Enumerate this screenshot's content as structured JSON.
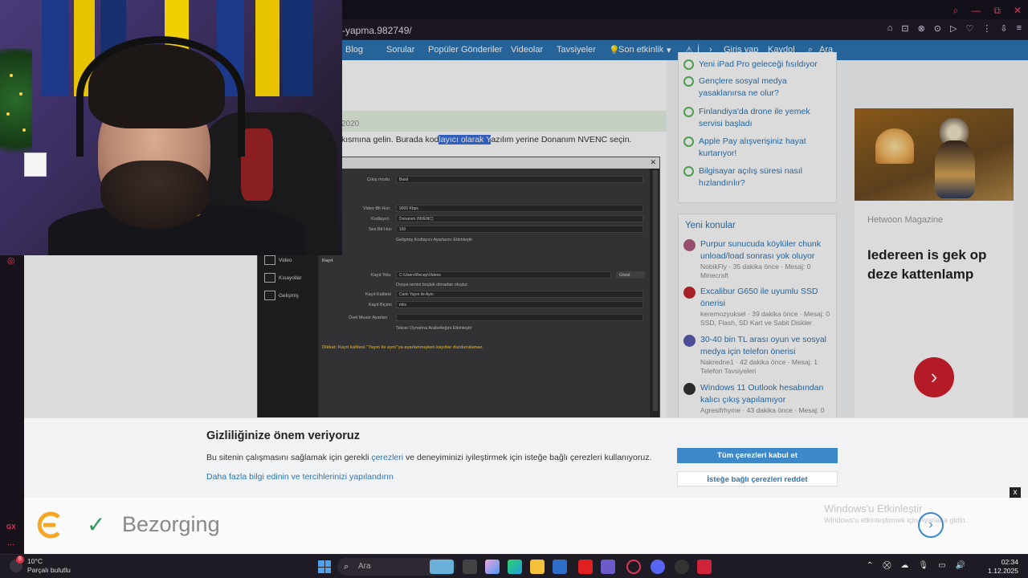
{
  "browser": {
    "url_fragment": "-yapma.982749/",
    "window_controls": [
      "⌕",
      "—",
      "⧉",
      "✕"
    ],
    "toolbar_icons": [
      "⌂",
      "⊡",
      "⊗",
      "⊙",
      "▷",
      "♡",
      "⋮",
      "⇩",
      "≡"
    ]
  },
  "opera_sidebar": {
    "gx_label": "GX",
    "dots": "..."
  },
  "nav": {
    "items": [
      "Blog",
      "Sorular",
      "Popüler Gönderiler",
      "Videolar",
      "Tavsiyeler",
      "Son etkinlik",
      "İ",
      "Giriş yap",
      "Kaydol",
      "Ara"
    ]
  },
  "post": {
    "date": "2020",
    "text_before": "kısmına gelin. Burada kod",
    "text_highlight": "layıcı olarak Y",
    "text_after": "azılım yerine Donanım NVENC seçin."
  },
  "obs": {
    "close": "✕",
    "left_items": [
      "Video",
      "Kısayollar",
      "Gelişmiş"
    ],
    "rows": [
      {
        "label": "Çıkış modu",
        "value": "Basit"
      },
      {
        "label": "Video Bit Hızı",
        "value": "9000 Kbps"
      },
      {
        "label": "Kodlayıcı",
        "value": "Donanım (NVENC)"
      },
      {
        "label": "Ses Bit Hızı",
        "value": "160"
      },
      {
        "label": "",
        "value": "Gelişmiş Kodlayıcı Ayarlarını Etkinleştir"
      },
      {
        "label": "Kayıt",
        "value": ""
      },
      {
        "label": "Kayıt Yolu",
        "value": "C:\\Users\\Recep\\Videos"
      },
      {
        "label": "",
        "value": "Dosya ismini boşluk olmadan oluştur"
      },
      {
        "label": "Kayıt Kalitesi",
        "value": "Canlı Yayın ile Aynı"
      },
      {
        "label": "Kayıt Biçimi",
        "value": "mkv"
      },
      {
        "label": "Özel Muxer Ayarları",
        "value": ""
      },
      {
        "label": "",
        "value": "Tekrar Oynatma Arabelleğini Etkinleştir"
      }
    ],
    "browse": "Gözat",
    "warning": "Dikkat: Kayıt kalitesi \"Yayın ile aynı\"ya ayarlanmışken kayıtlar durdurulamaz."
  },
  "sidebar_news": [
    "Yeni iPad Pro geleceği fısıldıyor",
    "Gençlere sosyal medya yasaklanırsa ne olur?",
    "Finlandiya'da drone ile yemek servisi başladı",
    "Apple Pay alışverişiniz hayat kurtarıyor!",
    "Bilgisayar açılış süresi nasıl hızlandırılır?"
  ],
  "new_threads": {
    "title": "Yeni konular",
    "items": [
      {
        "title": "Purpur sunucuda köylüler chunk unload/load sonrası yok oluyor",
        "meta": "NobikFly · 35 dakika önce · Mesaj: 0",
        "meta2": "Minecraft",
        "avatar_color": "#b05a80"
      },
      {
        "title": "Excalibur G650 ile uyumlu SSD önerisi",
        "meta": "keremozyuksel · 39 dakika önce · Mesaj: 0",
        "meta2": "SSD, Flash, SD Kart ve Sabit Diskler",
        "avatar_color": "#c0262e"
      },
      {
        "title": "30-40 bin TL arası oyun ve sosyal medya için telefon önerisi",
        "meta": "Nakredne1 · 42 dakika önce · Mesaj: 1",
        "meta2": "Telefon Tavsiyeleri",
        "avatar_color": "#5a5ab0"
      },
      {
        "title": "Windows 11 Outlook hesabından kalıcı çıkış yapılamıyor",
        "meta": "Agresifrhyme · 43 dakika önce · Mesaj: 0",
        "meta2": "",
        "avatar_color": "#333333"
      }
    ]
  },
  "ad": {
    "brand": "Hetwoon Magazine",
    "headline": "Iedereen is gek op deze kattenlamp",
    "arrow": "›"
  },
  "cookie": {
    "title": "Gizliliğinize önem veriyoruz",
    "text_before": "Bu sitenin çalışmasını sağlamak için gerekli ",
    "text_link": "çerezleri",
    "text_after": " ve deneyiminizi iyileştirmek için isteğe bağlı çerezleri kullanıyoruz.",
    "more_link": "Daha fazla bilgi edinin ve tercihlerinizi yapılandırın",
    "accept": "Tüm çerezleri kabul et",
    "reject": "İsteğe bağlı çerezleri reddet",
    "close": "x"
  },
  "bezorging": {
    "label": "Bezorging",
    "win_activate": "Windows'u Etkinleştir",
    "win_activate_sub": "Windows'u etkinleştirmek için Ayarlar'a gidin."
  },
  "taskbar": {
    "weather_badge": "8",
    "temperature": "10°C",
    "condition": "Parçalı bulutlu",
    "search_placeholder": "Ara",
    "time": "02:34",
    "date": "1.12.2025"
  },
  "webcam": {
    "flag_colors": [
      "#1d3a8a",
      "#e8c400",
      "#1a2f6e",
      "#f0d000",
      "#1d3a8a",
      "#153070"
    ]
  }
}
